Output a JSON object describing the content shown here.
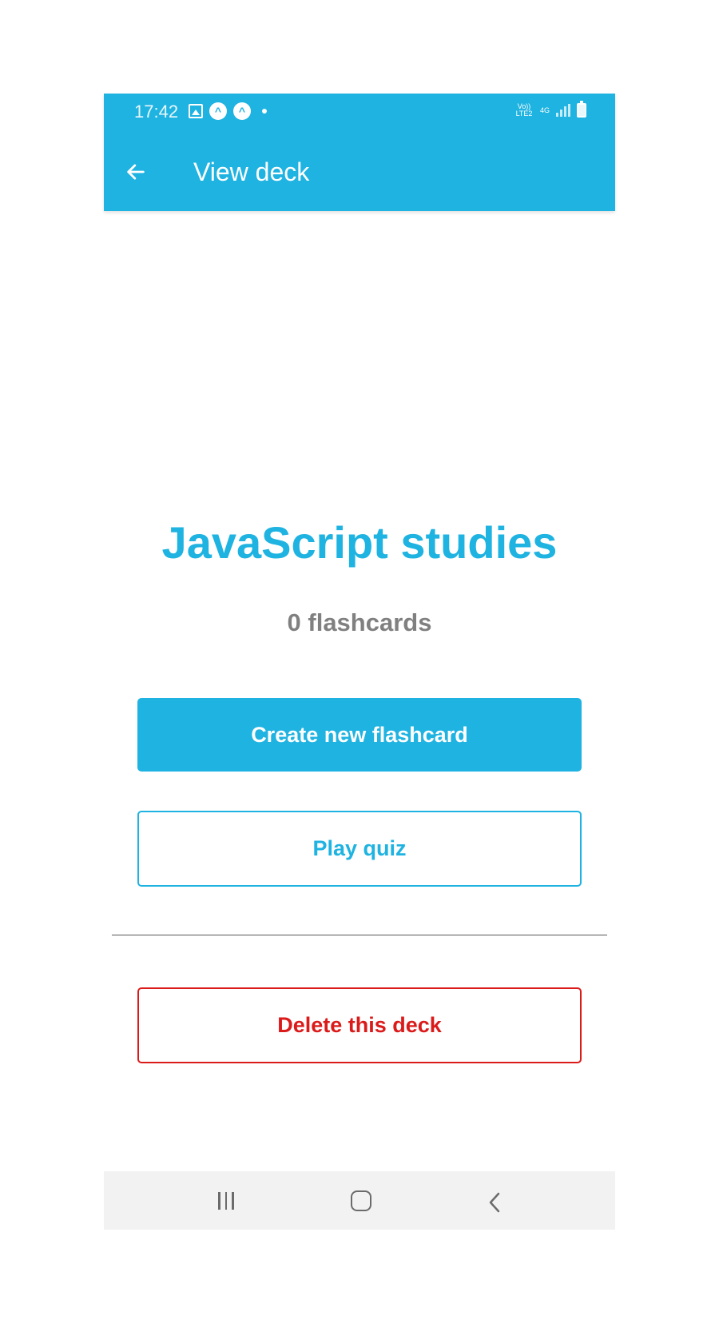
{
  "status_bar": {
    "time": "17:42",
    "volte_label": "Vo)) LTE2",
    "network_label": "4G"
  },
  "app_bar": {
    "title": "View deck",
    "back_icon": "arrow-left-icon",
    "color": "#1fb3e1"
  },
  "deck": {
    "title": "JavaScript studies",
    "count_label": "0 flashcards"
  },
  "actions": {
    "create_label": "Create new flashcard",
    "quiz_label": "Play quiz",
    "delete_label": "Delete this deck"
  },
  "colors": {
    "primary": "#1fb3e1",
    "danger": "#db1a1a",
    "muted": "#808080"
  },
  "nav_bar": {
    "recents_icon": "recents-icon",
    "home_icon": "home-icon",
    "back_icon": "chevron-left-icon"
  }
}
